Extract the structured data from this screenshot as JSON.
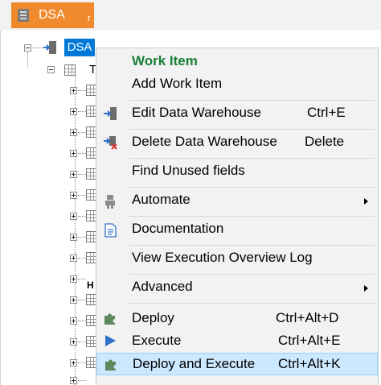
{
  "tab": {
    "label": "DSA",
    "extra": "r"
  },
  "tree": {
    "root_label": "DSA",
    "child_label": "T",
    "h_label": "H"
  },
  "context_menu": {
    "header": "Work Item",
    "items": {
      "add_work_item": "Add Work Item",
      "edit_dw": {
        "label": "Edit Data Warehouse",
        "shortcut": "Ctrl+E",
        "icon": "edit-warehouse-icon"
      },
      "delete_dw": {
        "label": "Delete Data Warehouse",
        "shortcut": "Delete",
        "icon": "delete-warehouse-icon"
      },
      "find_unused": "Find Unused fields",
      "automate": {
        "label": "Automate",
        "icon": "robot-icon",
        "has_submenu": true
      },
      "documentation": {
        "label": "Documentation",
        "icon": "document-icon"
      },
      "view_log": "View Execution Overview Log",
      "advanced": {
        "label": "Advanced",
        "has_submenu": true
      },
      "deploy": {
        "label": "Deploy",
        "shortcut": "Ctrl+Alt+D",
        "icon": "puzzle-icon"
      },
      "execute": {
        "label": "Execute",
        "shortcut": "Ctrl+Alt+E",
        "icon": "play-icon"
      },
      "deploy_execute": {
        "label": "Deploy and Execute",
        "shortcut": "Ctrl+Alt+K",
        "icon": "puzzle-icon"
      }
    }
  },
  "colors": {
    "tab_orange": "#f08a2c",
    "selection_blue": "#0078d7",
    "header_green": "#188038",
    "hover_fill": "#cce8ff",
    "hover_border": "#99d1ff",
    "deploy_green": "#5c8a5c",
    "execute_blue": "#2e6fc7"
  }
}
